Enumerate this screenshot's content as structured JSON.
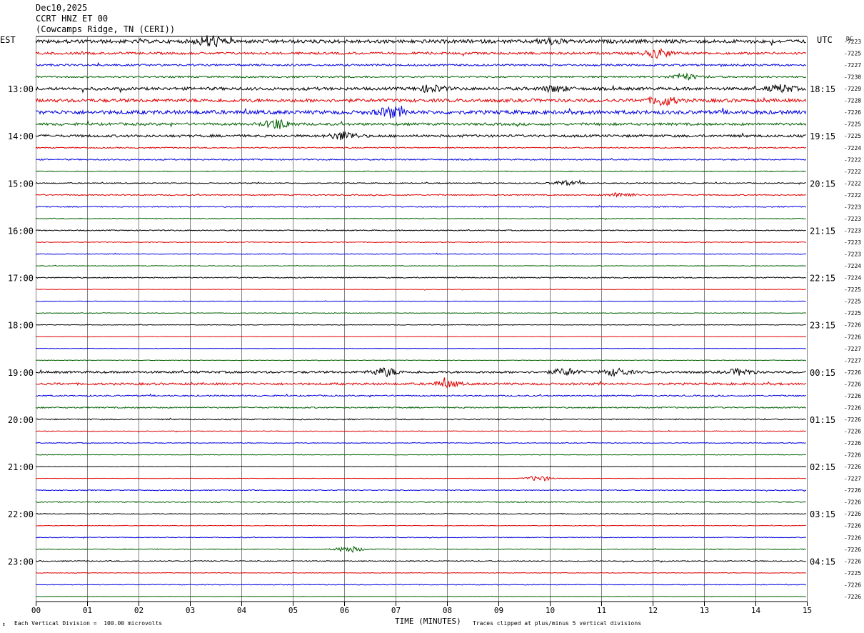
{
  "header": {
    "date": "Dec10,2025",
    "station": "CCRT HNZ ET 00",
    "location": "(Cowcamps Ridge, TN (CERI))"
  },
  "left_timezone": "EST",
  "right_timezone": "UTC",
  "dc_label": "DC",
  "footer": {
    "xlabel": "TIME (MINUTES)",
    "scale_note": "Each Vertical Division =  100.00 microvolts",
    "clip_note": "Traces clipped at plus/minus 5 vertical divisions"
  },
  "colors": {
    "trace_cycle": [
      "#000000",
      "#e00000",
      "#0000e0",
      "#006000"
    ],
    "grid": "#808080"
  },
  "chart_data": {
    "type": "line",
    "title": "CCRT HNZ ET 00",
    "xlabel": "TIME (MINUTES)",
    "x_ticks": [
      "00",
      "01",
      "02",
      "03",
      "04",
      "05",
      "06",
      "07",
      "08",
      "09",
      "10",
      "11",
      "12",
      "13",
      "14",
      "15"
    ],
    "xlim": [
      0,
      15
    ],
    "left_hour_labels": [
      "13:00",
      "14:00",
      "15:00",
      "16:00",
      "17:00",
      "18:00",
      "19:00",
      "20:00",
      "21:00",
      "22:00",
      "23:00"
    ],
    "right_hour_labels": [
      "18:15",
      "19:15",
      "20:15",
      "21:15",
      "22:15",
      "23:15",
      "00:15",
      "01:15",
      "02:15",
      "03:15",
      "04:15"
    ],
    "hour_label_first_row": 4,
    "rows_per_hour": 4,
    "dc_offsets": [
      "-7223",
      "-7225",
      "-7227",
      "-7230",
      "-7229",
      "-7228",
      "-7226",
      "-7225",
      "-7225",
      "-7224",
      "-7222",
      "-7222",
      "-7222",
      "-7222",
      "-7223",
      "-7223",
      "-7223",
      "-7223",
      "-7223",
      "-7224",
      "-7224",
      "-7225",
      "-7225",
      "-7225",
      "-7226",
      "-7226",
      "-7227",
      "-7227",
      "-7226",
      "-7226",
      "-7226",
      "-7226",
      "-7226",
      "-7226",
      "-7226",
      "-7226",
      "-7226",
      "-7227",
      "-7226",
      "-7226",
      "-7226",
      "-7226",
      "-7226",
      "-7226",
      "-7226",
      "-7225",
      "-7226",
      "-7226"
    ],
    "row_activity": [
      2.4,
      1.6,
      1.3,
      1.2,
      2.0,
      2.3,
      2.6,
      1.7,
      1.7,
      0.8,
      0.9,
      0.6,
      0.7,
      0.8,
      0.7,
      0.6,
      0.7,
      0.5,
      0.5,
      0.4,
      0.7,
      0.4,
      0.4,
      0.4,
      0.4,
      0.3,
      0.3,
      0.4,
      1.5,
      1.5,
      0.9,
      0.9,
      0.8,
      0.5,
      0.5,
      0.4,
      0.3,
      0.3,
      0.6,
      0.7,
      0.6,
      0.4,
      0.5,
      0.6,
      0.7,
      0.4,
      0.5,
      0.3
    ],
    "events": [
      {
        "row": 0,
        "minute": 3.4,
        "amp": 3.5
      },
      {
        "row": 0,
        "minute": 10.0,
        "amp": 1.5
      },
      {
        "row": 1,
        "minute": 12.1,
        "amp": 2.5
      },
      {
        "row": 3,
        "minute": 12.6,
        "amp": 2.0
      },
      {
        "row": 4,
        "minute": 7.7,
        "amp": 2.0
      },
      {
        "row": 4,
        "minute": 10.1,
        "amp": 1.8
      },
      {
        "row": 4,
        "minute": 14.5,
        "amp": 2.2
      },
      {
        "row": 5,
        "minute": 12.2,
        "amp": 2.8
      },
      {
        "row": 6,
        "minute": 6.9,
        "amp": 2.8
      },
      {
        "row": 7,
        "minute": 4.7,
        "amp": 3.0
      },
      {
        "row": 8,
        "minute": 6.0,
        "amp": 2.5
      },
      {
        "row": 12,
        "minute": 10.3,
        "amp": 1.5
      },
      {
        "row": 13,
        "minute": 11.4,
        "amp": 1.5
      },
      {
        "row": 28,
        "minute": 6.8,
        "amp": 2.5
      },
      {
        "row": 28,
        "minute": 10.3,
        "amp": 2.0
      },
      {
        "row": 28,
        "minute": 11.3,
        "amp": 2.2
      },
      {
        "row": 28,
        "minute": 13.7,
        "amp": 1.8
      },
      {
        "row": 29,
        "minute": 8.0,
        "amp": 1.8
      },
      {
        "row": 37,
        "minute": 9.8,
        "amp": 1.6
      },
      {
        "row": 43,
        "minute": 6.1,
        "amp": 1.8
      }
    ]
  }
}
